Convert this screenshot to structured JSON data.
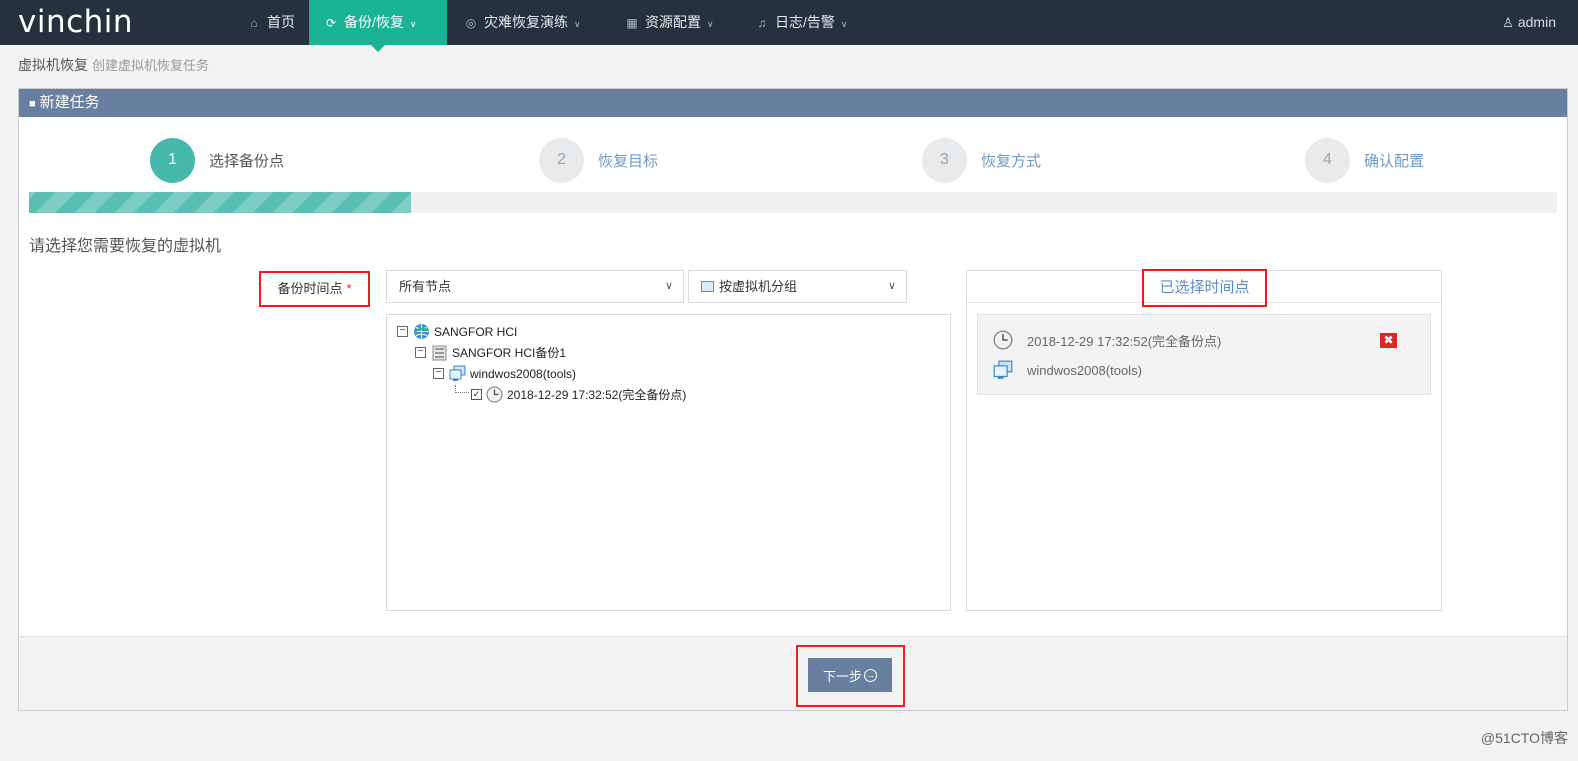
{
  "nav": {
    "logo": "vinchin",
    "items": [
      {
        "label": "首页",
        "icon": "home-icon",
        "active": false
      },
      {
        "label": "备份/恢复",
        "icon": "sync-icon",
        "active": true
      },
      {
        "label": "灾难恢复演练",
        "icon": "drill-icon",
        "active": false
      },
      {
        "label": "资源配置",
        "icon": "grid-icon",
        "active": false
      },
      {
        "label": "日志/告警",
        "icon": "bell-icon",
        "active": false
      }
    ],
    "user": "admin"
  },
  "breadcrumb": {
    "title": "虚拟机恢复",
    "subtitle": "创建虚拟机恢复任务"
  },
  "panel": {
    "title": "新建任务"
  },
  "steps": [
    {
      "number": "1",
      "label": "选择备份点",
      "active": true
    },
    {
      "number": "2",
      "label": "恢复目标",
      "active": false
    },
    {
      "number": "3",
      "label": "恢复方式",
      "active": false
    },
    {
      "number": "4",
      "label": "确认配置",
      "active": false
    }
  ],
  "progress": {
    "percent": 25
  },
  "prompt": "请选择您需要恢复的虚拟机",
  "form": {
    "label": "备份时间点",
    "required_mark": "*",
    "node_select": "所有节点",
    "group_select": "按虚拟机分组"
  },
  "tree": {
    "root": "SANGFOR HCI",
    "storage": "SANGFOR HCI备份1",
    "vm": "windwos2008(tools)",
    "point": "2018-12-29 17:32:52(完全备份点)"
  },
  "selected": {
    "title": "已选择时间点",
    "time": "2018-12-29 17:32:52(完全备份点)",
    "vm": "windwos2008(tools)",
    "delete_glyph": "✖"
  },
  "footer": {
    "next_label": "下一步"
  },
  "watermark": "@51CTO博客",
  "colors": {
    "nav_bg": "#26313e",
    "accent": "#1ab394",
    "panel_head": "#687f9f",
    "step_active": "#45b8ab",
    "highlight": "#e8201f"
  }
}
